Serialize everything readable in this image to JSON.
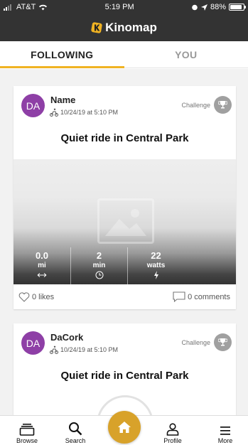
{
  "status_bar": {
    "carrier": "AT&T",
    "time": "5:19 PM",
    "battery": "88%",
    "battery_level": 0.88
  },
  "header": {
    "title": "Kinomap",
    "brand_color": "#f0b323"
  },
  "tabs": [
    {
      "label": "FOLLOWING",
      "active": true
    },
    {
      "label": "YOU",
      "active": false
    }
  ],
  "feed": [
    {
      "avatar_initials": "DA",
      "user_name": "Name",
      "timestamp": "10/24/19 at 5:10 PM",
      "badge_label": "Challenge",
      "title": "Quiet ride in Central Park",
      "stats": [
        {
          "value": "0.0",
          "unit": "mi",
          "icon": "arrows-horizontal-icon"
        },
        {
          "value": "2",
          "unit": "min",
          "icon": "clock-icon"
        },
        {
          "value": "22",
          "unit": "watts",
          "icon": "lightning-icon"
        }
      ],
      "likes": "0 likes",
      "comments": "0 comments"
    },
    {
      "avatar_initials": "DA",
      "user_name": "DaCork",
      "timestamp": "10/24/19 at 5:10 PM",
      "badge_label": "Challenge",
      "title": "Quiet ride in Central Park"
    }
  ],
  "bottom_nav": {
    "browse": "Browse",
    "search": "Search",
    "profile": "Profile",
    "more": "More",
    "home_color": "#d8a22a"
  }
}
